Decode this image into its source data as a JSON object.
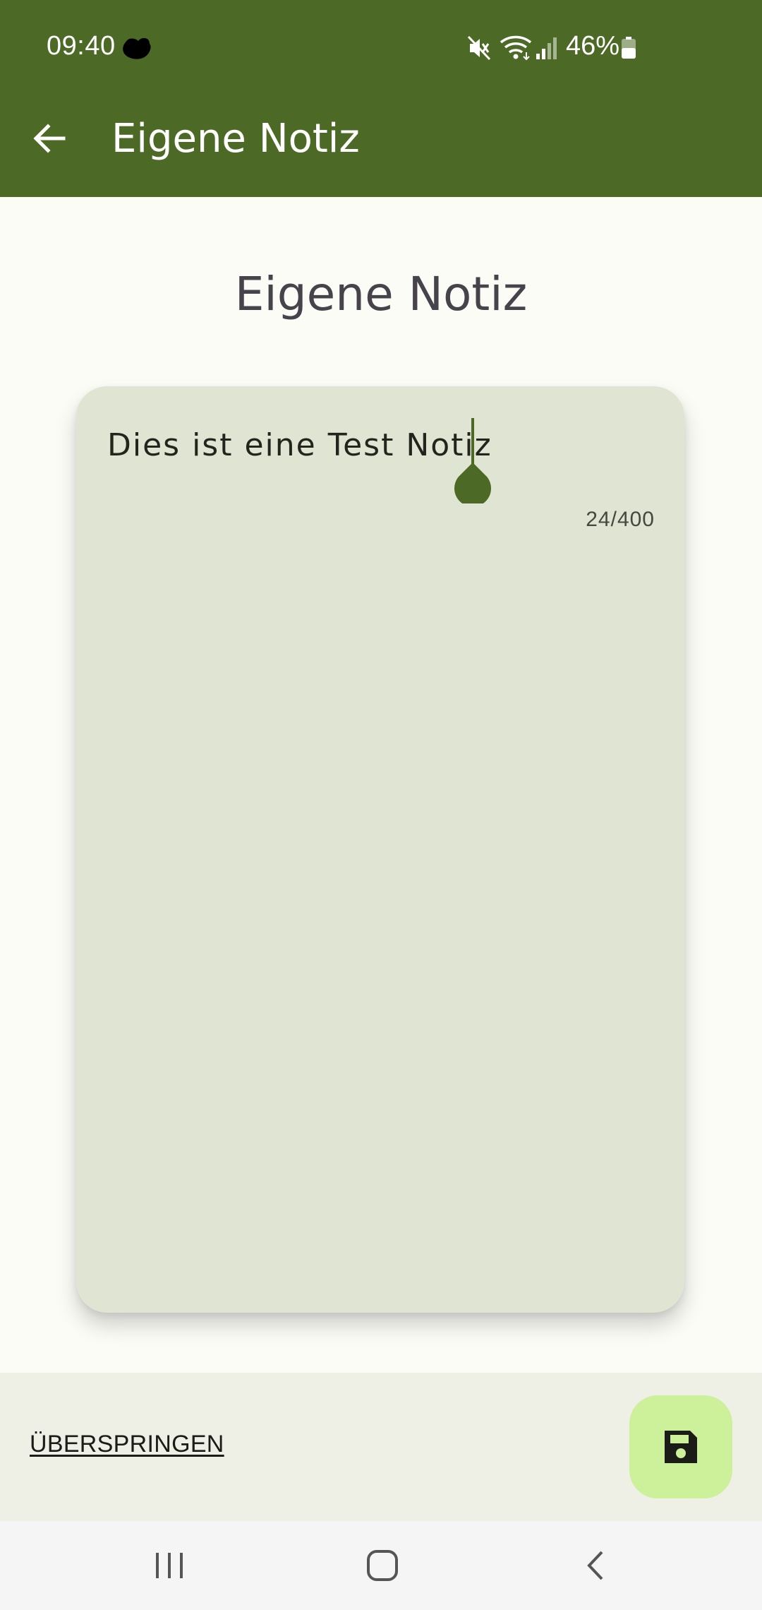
{
  "status_bar": {
    "time": "09:40",
    "battery_percent": "46%",
    "battery_level": 0.46,
    "icons": [
      "notification-icon",
      "mute-icon",
      "wifi-icon",
      "signal-icon",
      "battery-icon"
    ]
  },
  "app_bar": {
    "title": "Eigene Notiz",
    "back_icon": "arrow-back-icon",
    "background": "#4C6A26"
  },
  "main": {
    "heading": "Eigene Notiz",
    "note": {
      "value": "Dies ist eine Test Notiz",
      "counter": "24/400",
      "card_color": "#E0E4D3"
    }
  },
  "bottom_bar": {
    "skip_label": "ÜBERSPRINGEN",
    "save_icon": "save-floppy-icon",
    "fab_color": "#CDF09A"
  },
  "nav_bar": {
    "icons": [
      "recent-apps-icon",
      "home-icon",
      "back-icon"
    ]
  }
}
